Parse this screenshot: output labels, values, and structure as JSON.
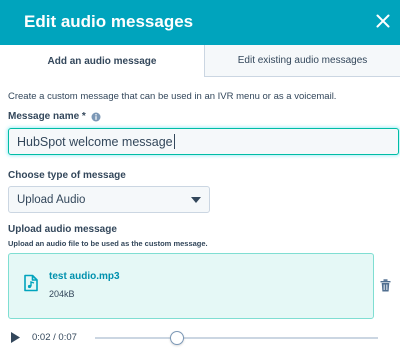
{
  "dialog": {
    "title": "Edit audio messages",
    "close_icon": "close-icon"
  },
  "tabs": [
    {
      "label": "Add an audio message",
      "active": true
    },
    {
      "label": "Edit existing audio messages",
      "active": false
    }
  ],
  "description": "Create a custom message that can be used in an IVR menu or as a voicemail.",
  "message_name": {
    "label": "Message name *",
    "value": "HubSpot welcome message",
    "info_icon": "info-icon"
  },
  "message_type": {
    "label": "Choose type of message",
    "selected": "Upload Audio",
    "icon": "caret-down-icon"
  },
  "upload": {
    "label": "Upload audio message",
    "hint": "Upload an audio file to be used as the custom message.",
    "file_name": "test audio.mp3",
    "file_size": "204kB",
    "file_icon": "audio-file-icon",
    "delete_icon": "trash-icon"
  },
  "player": {
    "time": "0:02 / 0:07",
    "progress": 0.29,
    "play_icon": "play-icon"
  },
  "colors": {
    "header": "#00a4bd",
    "accent_teal": "#00bda5",
    "text": "#33475b",
    "link": "#0091ae"
  }
}
